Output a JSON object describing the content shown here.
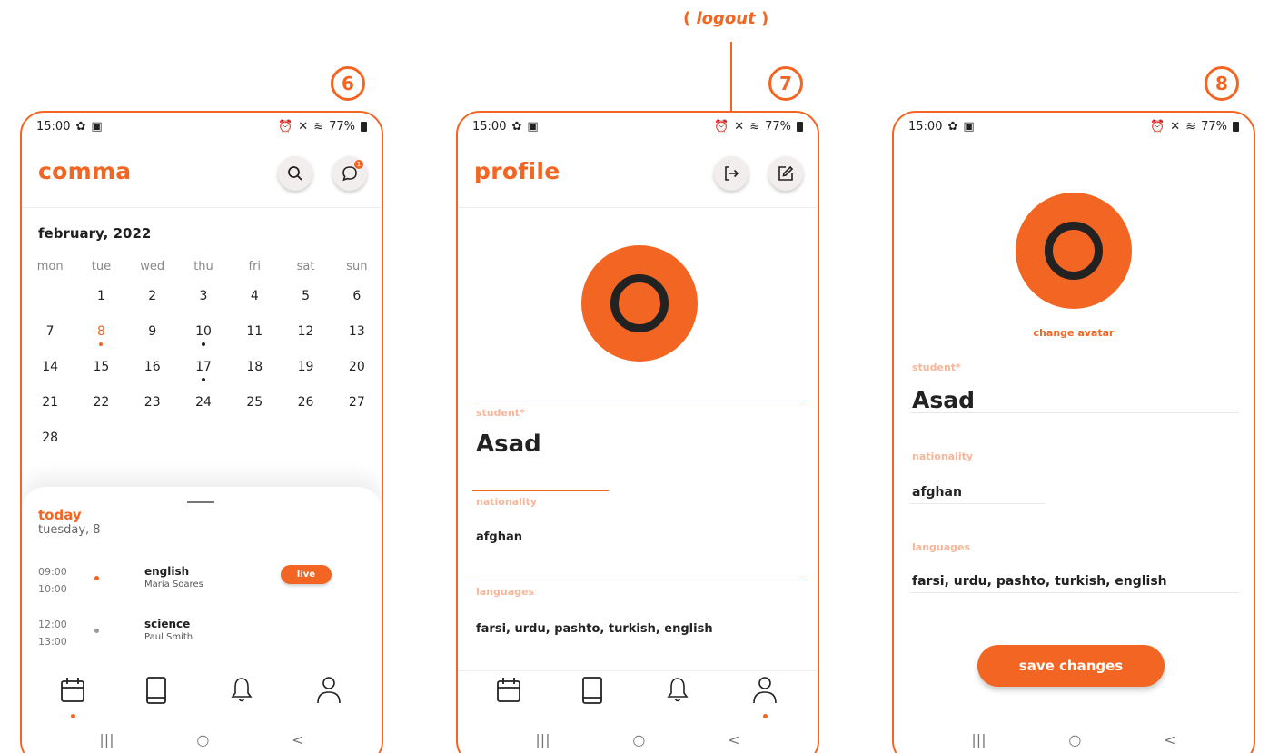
{
  "annotations": {
    "step6": "6",
    "step7": "7",
    "step8": "8",
    "logout_open": "(",
    "logout_label": "logout",
    "logout_close": ")"
  },
  "statusbar": {
    "time": "15:00",
    "battery": "77%"
  },
  "screen6": {
    "title": "comma",
    "badge_count": "1",
    "month": "february, 2022",
    "weekdays": [
      "mon",
      "tue",
      "wed",
      "thu",
      "fri",
      "sat",
      "sun"
    ],
    "days": [
      "",
      "1",
      "2",
      "3",
      "4",
      "5",
      "6",
      "7",
      "8",
      "9",
      "10",
      "11",
      "12",
      "13",
      "14",
      "15",
      "16",
      "17",
      "18",
      "19",
      "20",
      "21",
      "22",
      "23",
      "24",
      "25",
      "26",
      "27",
      "28"
    ],
    "today_label": "today",
    "today_date": "tuesday, 8",
    "lessons": [
      {
        "start": "09:00",
        "end": "10:00",
        "subject": "english",
        "teacher": "Maria Soares",
        "status": "live"
      },
      {
        "start": "12:00",
        "end": "13:00",
        "subject": "science",
        "teacher": "Paul Smith"
      }
    ]
  },
  "screen7": {
    "title": "profile",
    "student_label": "student*",
    "student_name": "Asad",
    "nationality_label": "nationality",
    "nationality": "afghan",
    "languages_label": "languages",
    "languages": "farsi, urdu, pashto, turkish, english"
  },
  "screen8": {
    "change_avatar": "change avatar",
    "student_label": "student*",
    "student_name": "Asad",
    "nationality_label": "nationality",
    "nationality": "afghan",
    "languages_label": "languages",
    "languages": "farsi, urdu, pashto, turkish, english",
    "save_label": "save changes"
  },
  "system_nav": {
    "recents": "|||",
    "home": "○",
    "back": "<"
  },
  "colors": {
    "accent": "#F26522",
    "label_light": "#f7b69a"
  },
  "icons": [
    "search-icon",
    "chat-icon",
    "logout-icon",
    "edit-icon",
    "calendar-icon",
    "book-icon",
    "bell-icon",
    "user-icon",
    "settings-icon",
    "wifi-icon",
    "alarm-icon",
    "mute-icon"
  ]
}
